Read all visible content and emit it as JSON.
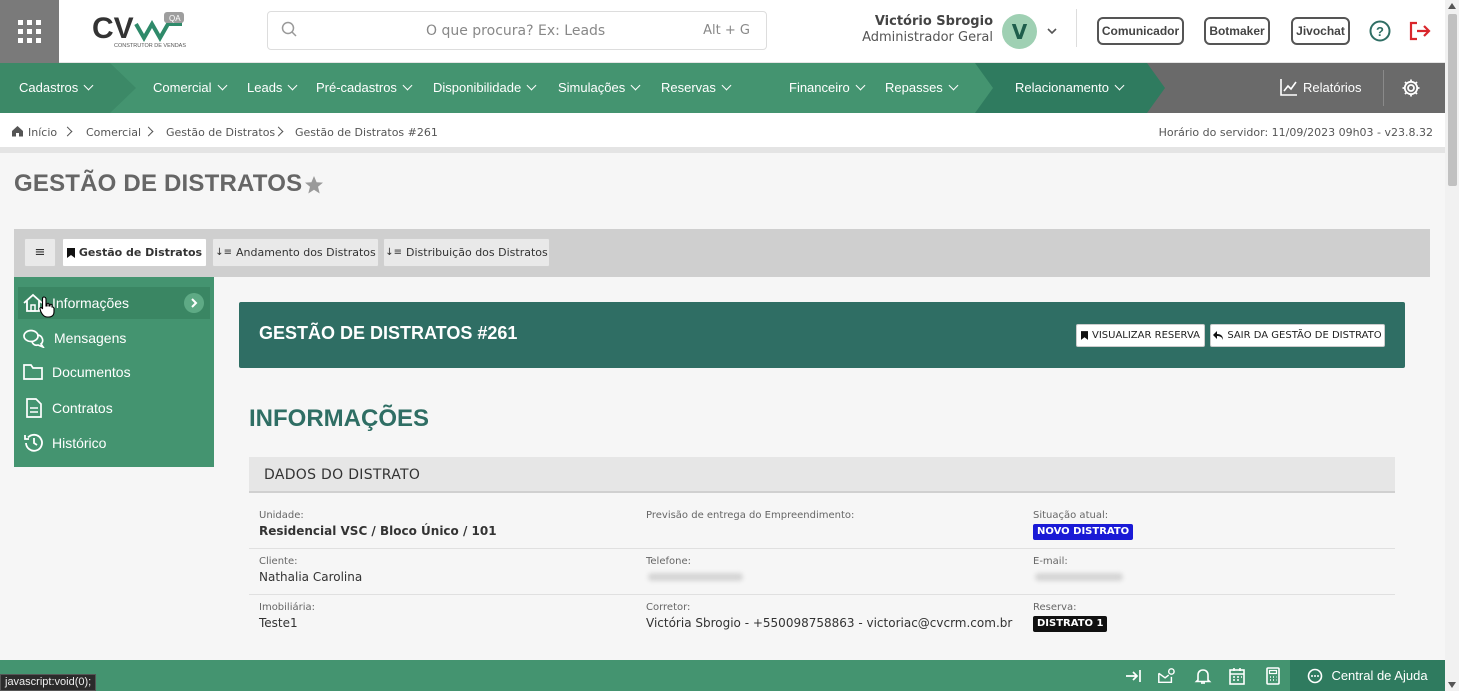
{
  "header": {
    "search_placeholder": "O que procura? Ex: Leads",
    "search_shortcut": "Alt + G",
    "logo_tag": "QA",
    "logo_sub": "CONSTRUTOR DE VENDAS",
    "user_name": "Victório Sbrogio",
    "user_role": "Administrador Geral",
    "avatar_letter": "V",
    "buttons": [
      "Comunicador",
      "Botmaker",
      "Jivochat"
    ]
  },
  "nav": {
    "items": [
      "Cadastros",
      "Comercial",
      "Leads",
      "Pré-cadastros",
      "Disponibilidade",
      "Simulações",
      "Reservas",
      "Financeiro",
      "Repasses",
      "Relacionamento"
    ],
    "reports": "Relatórios"
  },
  "breadcrumb": {
    "items": [
      "Início",
      "Comercial",
      "Gestão de Distratos",
      "Gestão de Distratos #261"
    ],
    "server_time": "Horário do servidor: 11/09/2023 09h03 - v23.8.32"
  },
  "page": {
    "title": "GESTÃO DE DISTRATOS",
    "tabs": [
      "Gestão de Distratos",
      "Andamento dos Distratos",
      "Distribuição dos Distratos"
    ]
  },
  "side_menu": [
    "Informações",
    "Mensagens",
    "Documentos",
    "Contratos",
    "Histórico"
  ],
  "card": {
    "title": "GESTÃO DE DISTRATOS #261",
    "btn_view": "VISUALIZAR RESERVA",
    "btn_exit": "SAIR DA GESTÃO DE DISTRATO"
  },
  "info": {
    "section_title": "INFORMAÇÕES",
    "group_title": "DADOS DO DISTRATO",
    "unidade_label": "Unidade:",
    "unidade": "Residencial VSC / Bloco Único / 101",
    "previsao_label": "Previsão de entrega do Empreendimento:",
    "situacao_label": "Situação atual:",
    "situacao": "NOVO DISTRATO",
    "cliente_label": "Cliente:",
    "cliente": "Nathalia Carolina",
    "telefone_label": "Telefone:",
    "email_label": "E-mail:",
    "imobiliaria_label": "Imobiliária:",
    "imobiliaria": "Teste1",
    "corretor_label": "Corretor:",
    "corretor": "Victória Sbrogio - +550098758863 - victoriac@cvcrm.com.br",
    "reserva_label": "Reserva:",
    "reserva": "DISTRATO 1"
  },
  "footer": {
    "help_center": "Central de Ajuda",
    "status_url": "javascript:void(0);"
  },
  "colors": {
    "primary_green": "#449470",
    "dark_teal": "#2f6e64",
    "situacao_badge": "#1a1ad6",
    "reserva_badge": "#111111",
    "logout": "#d9262c"
  }
}
